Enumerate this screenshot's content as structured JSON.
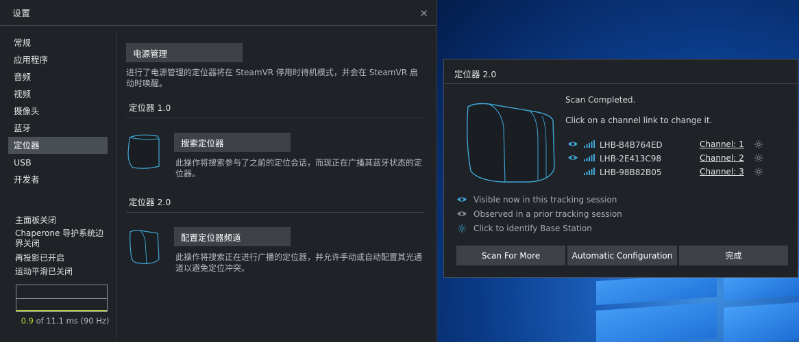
{
  "settings": {
    "title": "设置",
    "close_glyph": "×",
    "sidebar": {
      "items": [
        {
          "label": "常规"
        },
        {
          "label": "应用程序"
        },
        {
          "label": "音频"
        },
        {
          "label": "视频"
        },
        {
          "label": "摄像头"
        },
        {
          "label": "蓝牙"
        },
        {
          "label": "定位器",
          "active": true
        },
        {
          "label": "USB"
        },
        {
          "label": "开发者"
        }
      ],
      "status": [
        "主面板关闭",
        "Chaperone 导护系统边界关闭",
        "再投影已开启",
        "运动平滑已关闭"
      ],
      "perf": {
        "value": "0.9",
        "rest": "of 11.1 ms (90 Hz)"
      }
    },
    "content": {
      "power_button": "电源管理",
      "power_desc": "进行了电源管理的定位器将在 SteamVR 停用时待机模式，并会在 SteamVR 启动时唤醒。",
      "section1": {
        "header": "定位器 1.0",
        "button": "搜索定位器",
        "desc": "此操作将搜索参与了之前的定位会话，而现正在广播其蓝牙状态的定位器。"
      },
      "section2": {
        "header": "定位器 2.0",
        "button": "配置定位器频道",
        "desc": "此操作将搜索正在进行广播的定位器，并允许手动或自动配置其光通道以避免定位冲突。"
      }
    }
  },
  "dialog": {
    "title": "定位器 2.0",
    "status": "Scan Completed.",
    "hint": "Click on a channel link to change it.",
    "stations": [
      {
        "name": "LHB-B4B764ED",
        "channel": "Channel: 1",
        "visibility": "visible-now"
      },
      {
        "name": "LHB-2E413C98",
        "channel": "Channel: 2",
        "visibility": "visible-now"
      },
      {
        "name": "LHB-98B82B05",
        "channel": "Channel: 3",
        "visibility": "none"
      }
    ],
    "legend": [
      {
        "icon": "eye-bright-icon",
        "text": "Visible now in this tracking session"
      },
      {
        "icon": "eye-dim-icon",
        "text": "Observed in a prior tracking session"
      },
      {
        "icon": "identify-icon",
        "text": "Click to identify Base Station"
      }
    ],
    "buttons": {
      "scan": "Scan For More",
      "auto": "Automatic Configuration",
      "done": "完成"
    }
  },
  "colors": {
    "accent": "#3fa8d8",
    "perf_green": "#b7d33a",
    "panel_bg": "#1f2226",
    "button_bg": "#3e4248"
  }
}
